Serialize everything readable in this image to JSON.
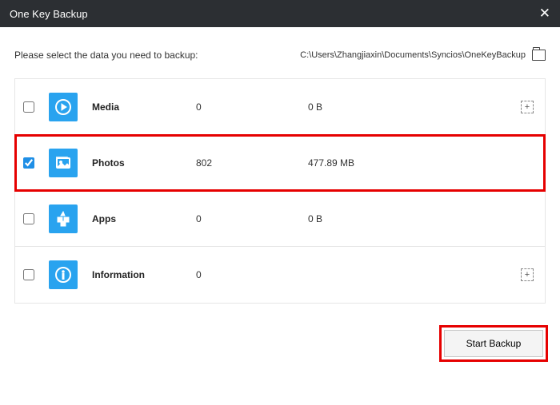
{
  "title": "One Key Backup",
  "prompt": "Please select the data you need to backup:",
  "path": "C:\\Users\\Zhangjiaxin\\Documents\\Syncios\\OneKeyBackup",
  "rows": [
    {
      "icon": "media",
      "label": "Media",
      "count": "0",
      "size": "0 B",
      "checked": false,
      "hasAdd": true,
      "highlight": false
    },
    {
      "icon": "photos",
      "label": "Photos",
      "count": "802",
      "size": "477.89 MB",
      "checked": true,
      "hasAdd": false,
      "highlight": true
    },
    {
      "icon": "apps",
      "label": "Apps",
      "count": "0",
      "size": "0 B",
      "checked": false,
      "hasAdd": false,
      "highlight": false
    },
    {
      "icon": "info",
      "label": "Information",
      "count": "0",
      "size": "",
      "checked": false,
      "hasAdd": true,
      "highlight": false
    }
  ],
  "start_label": "Start Backup"
}
